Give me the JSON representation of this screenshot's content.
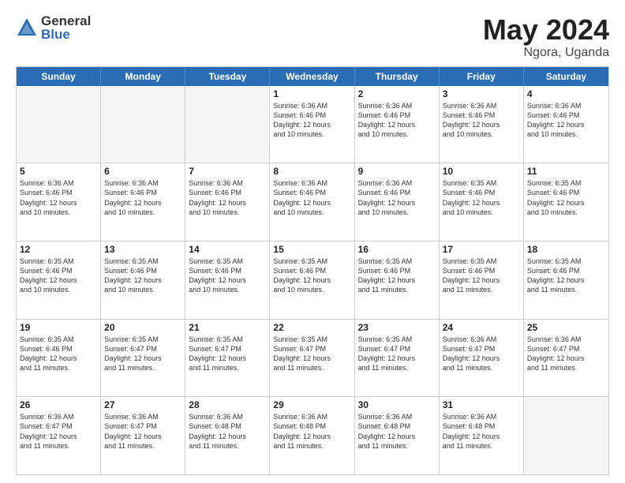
{
  "logo": {
    "general": "General",
    "blue": "Blue"
  },
  "title": {
    "month": "May 2024",
    "location": "Ngora, Uganda"
  },
  "header_days": [
    "Sunday",
    "Monday",
    "Tuesday",
    "Wednesday",
    "Thursday",
    "Friday",
    "Saturday"
  ],
  "rows": [
    [
      {
        "day": "",
        "info": "",
        "empty": true
      },
      {
        "day": "",
        "info": "",
        "empty": true
      },
      {
        "day": "",
        "info": "",
        "empty": true
      },
      {
        "day": "1",
        "info": "Sunrise: 6:36 AM\nSunset: 6:46 PM\nDaylight: 12 hours\nand 10 minutes."
      },
      {
        "day": "2",
        "info": "Sunrise: 6:36 AM\nSunset: 6:46 PM\nDaylight: 12 hours\nand 10 minutes."
      },
      {
        "day": "3",
        "info": "Sunrise: 6:36 AM\nSunset: 6:46 PM\nDaylight: 12 hours\nand 10 minutes."
      },
      {
        "day": "4",
        "info": "Sunrise: 6:36 AM\nSunset: 6:46 PM\nDaylight: 12 hours\nand 10 minutes."
      }
    ],
    [
      {
        "day": "5",
        "info": "Sunrise: 6:36 AM\nSunset: 6:46 PM\nDaylight: 12 hours\nand 10 minutes."
      },
      {
        "day": "6",
        "info": "Sunrise: 6:36 AM\nSunset: 6:46 PM\nDaylight: 12 hours\nand 10 minutes."
      },
      {
        "day": "7",
        "info": "Sunrise: 6:36 AM\nSunset: 6:46 PM\nDaylight: 12 hours\nand 10 minutes."
      },
      {
        "day": "8",
        "info": "Sunrise: 6:36 AM\nSunset: 6:46 PM\nDaylight: 12 hours\nand 10 minutes."
      },
      {
        "day": "9",
        "info": "Sunrise: 6:36 AM\nSunset: 6:46 PM\nDaylight: 12 hours\nand 10 minutes."
      },
      {
        "day": "10",
        "info": "Sunrise: 6:35 AM\nSunset: 6:46 PM\nDaylight: 12 hours\nand 10 minutes."
      },
      {
        "day": "11",
        "info": "Sunrise: 6:35 AM\nSunset: 6:46 PM\nDaylight: 12 hours\nand 10 minutes."
      }
    ],
    [
      {
        "day": "12",
        "info": "Sunrise: 6:35 AM\nSunset: 6:46 PM\nDaylight: 12 hours\nand 10 minutes."
      },
      {
        "day": "13",
        "info": "Sunrise: 6:35 AM\nSunset: 6:46 PM\nDaylight: 12 hours\nand 10 minutes."
      },
      {
        "day": "14",
        "info": "Sunrise: 6:35 AM\nSunset: 6:46 PM\nDaylight: 12 hours\nand 10 minutes."
      },
      {
        "day": "15",
        "info": "Sunrise: 6:35 AM\nSunset: 6:46 PM\nDaylight: 12 hours\nand 10 minutes."
      },
      {
        "day": "16",
        "info": "Sunrise: 6:35 AM\nSunset: 6:46 PM\nDaylight: 12 hours\nand 11 minutes."
      },
      {
        "day": "17",
        "info": "Sunrise: 6:35 AM\nSunset: 6:46 PM\nDaylight: 12 hours\nand 11 minutes."
      },
      {
        "day": "18",
        "info": "Sunrise: 6:35 AM\nSunset: 6:46 PM\nDaylight: 12 hours\nand 11 minutes."
      }
    ],
    [
      {
        "day": "19",
        "info": "Sunrise: 6:35 AM\nSunset: 6:46 PM\nDaylight: 12 hours\nand 11 minutes."
      },
      {
        "day": "20",
        "info": "Sunrise: 6:35 AM\nSunset: 6:47 PM\nDaylight: 12 hours\nand 11 minutes."
      },
      {
        "day": "21",
        "info": "Sunrise: 6:35 AM\nSunset: 6:47 PM\nDaylight: 12 hours\nand 11 minutes."
      },
      {
        "day": "22",
        "info": "Sunrise: 6:35 AM\nSunset: 6:47 PM\nDaylight: 12 hours\nand 11 minutes."
      },
      {
        "day": "23",
        "info": "Sunrise: 6:35 AM\nSunset: 6:47 PM\nDaylight: 12 hours\nand 11 minutes."
      },
      {
        "day": "24",
        "info": "Sunrise: 6:36 AM\nSunset: 6:47 PM\nDaylight: 12 hours\nand 11 minutes."
      },
      {
        "day": "25",
        "info": "Sunrise: 6:36 AM\nSunset: 6:47 PM\nDaylight: 12 hours\nand 11 minutes."
      }
    ],
    [
      {
        "day": "26",
        "info": "Sunrise: 6:36 AM\nSunset: 6:47 PM\nDaylight: 12 hours\nand 11 minutes."
      },
      {
        "day": "27",
        "info": "Sunrise: 6:36 AM\nSunset: 6:47 PM\nDaylight: 12 hours\nand 11 minutes."
      },
      {
        "day": "28",
        "info": "Sunrise: 6:36 AM\nSunset: 6:48 PM\nDaylight: 12 hours\nand 11 minutes."
      },
      {
        "day": "29",
        "info": "Sunrise: 6:36 AM\nSunset: 6:48 PM\nDaylight: 12 hours\nand 11 minutes."
      },
      {
        "day": "30",
        "info": "Sunrise: 6:36 AM\nSunset: 6:48 PM\nDaylight: 12 hours\nand 11 minutes."
      },
      {
        "day": "31",
        "info": "Sunrise: 6:36 AM\nSunset: 6:48 PM\nDaylight: 12 hours\nand 11 minutes."
      },
      {
        "day": "",
        "info": "",
        "empty": true
      }
    ]
  ]
}
